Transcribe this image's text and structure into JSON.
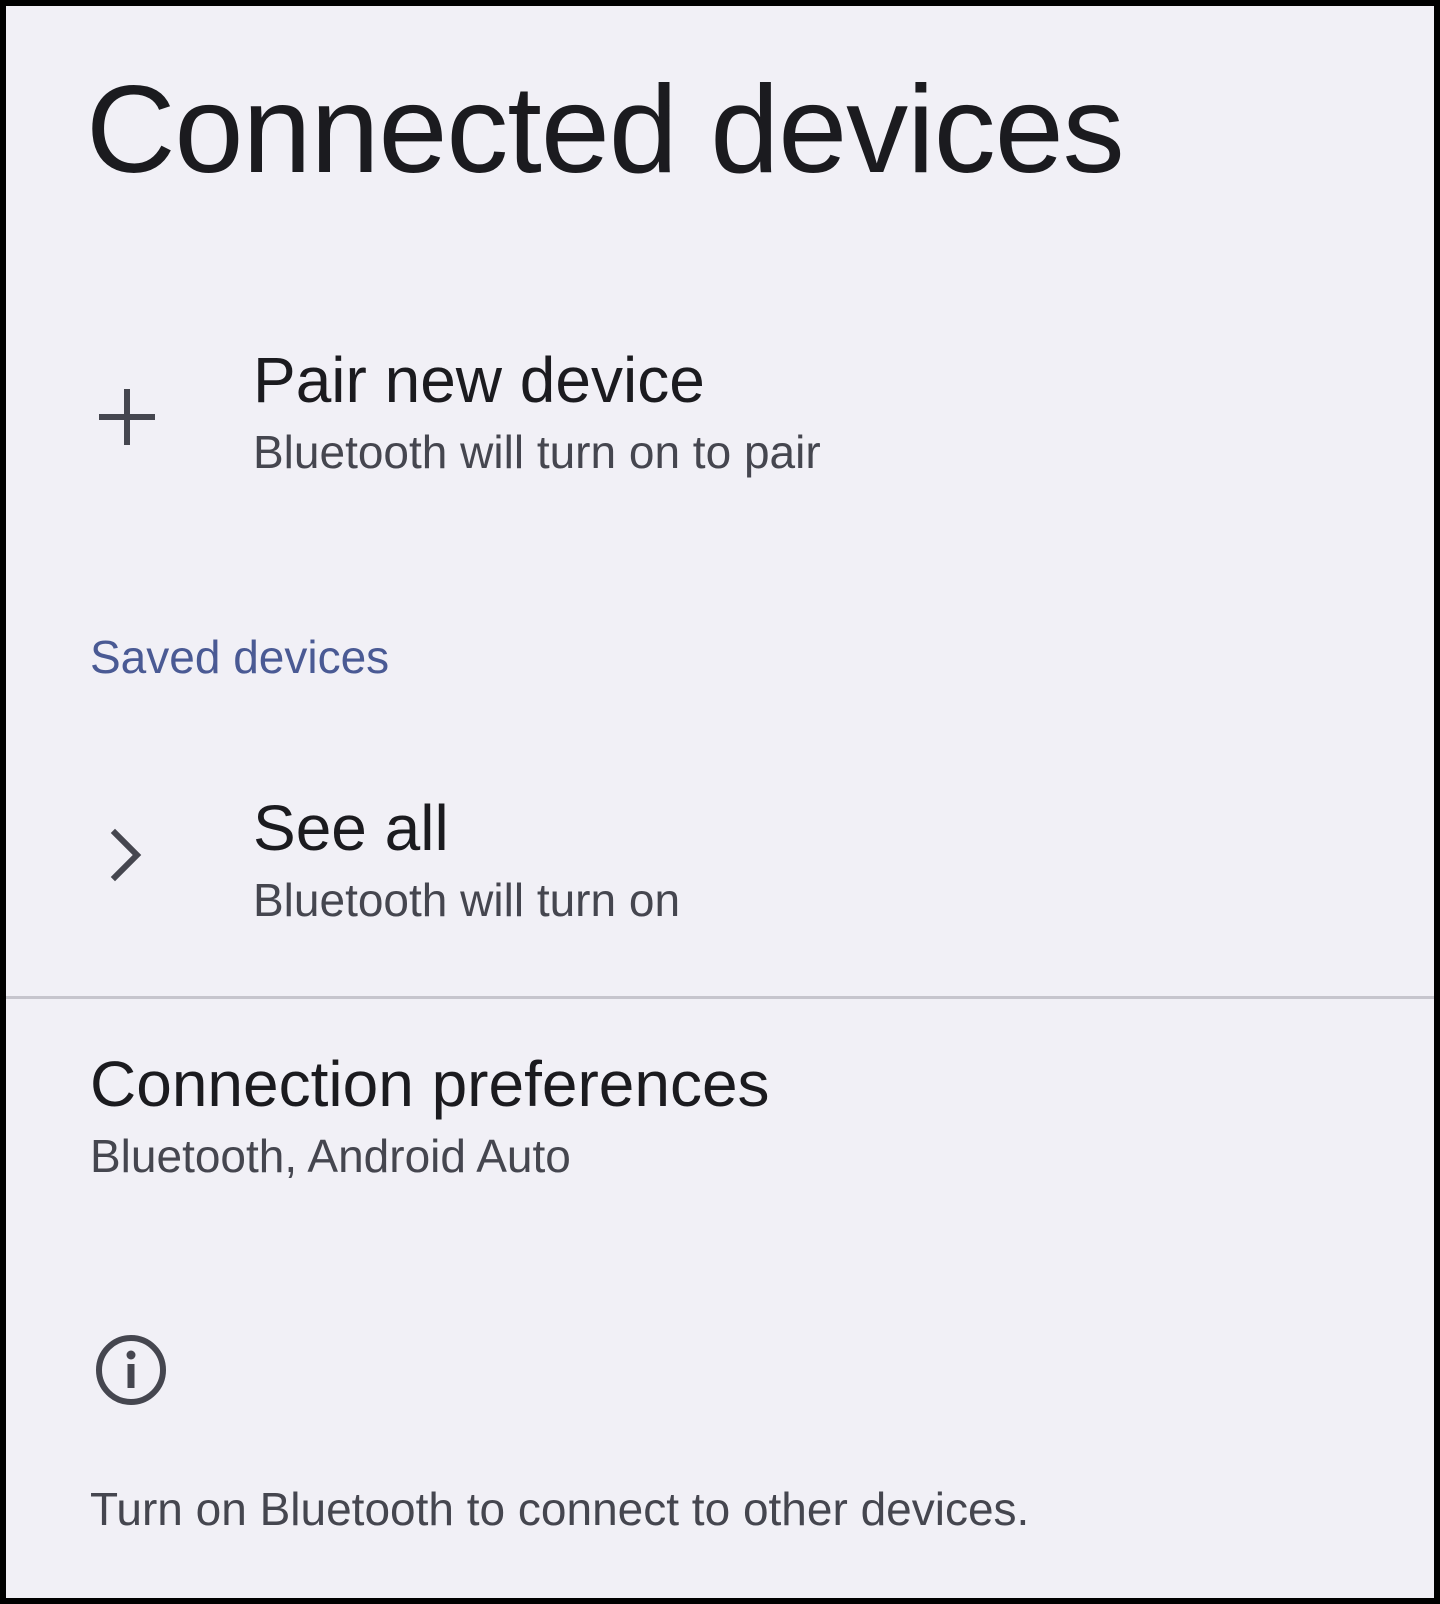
{
  "page": {
    "title": "Connected devices"
  },
  "pair_new_device": {
    "title": "Pair new device",
    "summary": "Bluetooth will turn on to pair",
    "icon": "plus-icon"
  },
  "saved_devices": {
    "header": "Saved devices",
    "see_all": {
      "title": "See all",
      "summary": "Bluetooth will turn on",
      "icon": "chevron-right-icon"
    }
  },
  "connection_preferences": {
    "title": "Connection preferences",
    "summary": "Bluetooth, Android Auto"
  },
  "footer": {
    "icon": "info-icon",
    "text": "Turn on Bluetooth to connect to other devices."
  },
  "colors": {
    "background": "#f1f0f6",
    "text_primary": "#1b1b1f",
    "text_secondary": "#45464f",
    "accent": "#4a5a94",
    "divider": "#c6c5cd"
  }
}
